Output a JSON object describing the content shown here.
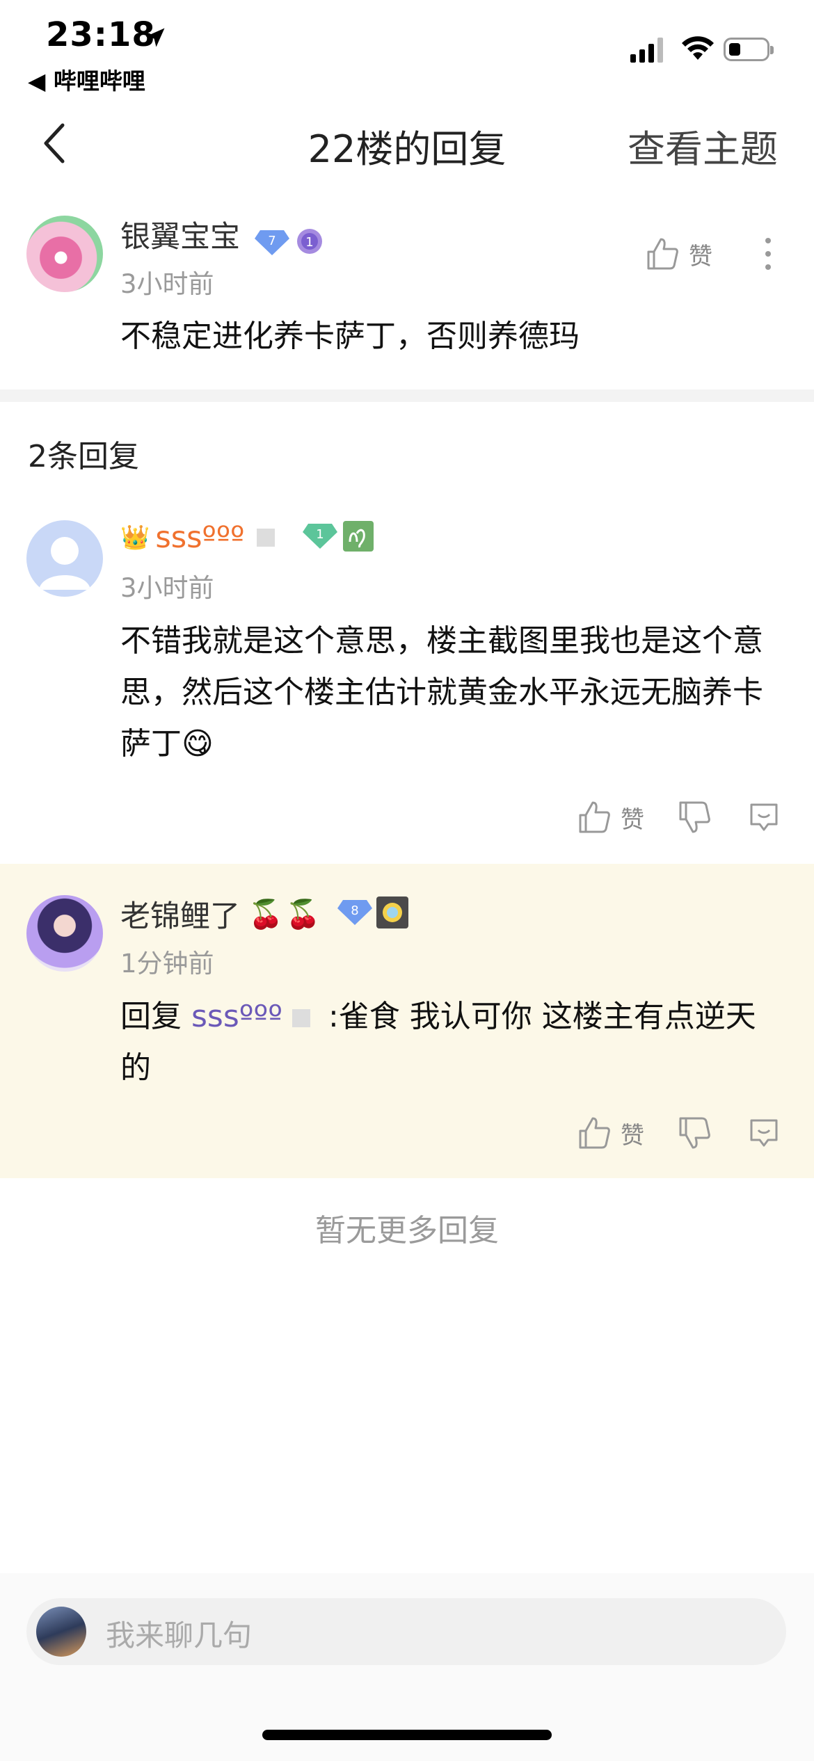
{
  "status": {
    "time": "23:18",
    "back_app": "◀ 哔哩哔哩"
  },
  "nav": {
    "title": "22楼的回复",
    "topic_link": "查看主题"
  },
  "main_post": {
    "user": "银翼宝宝",
    "level": "7",
    "badge": "1",
    "time": "3小时前",
    "content": "不稳定进化养卡萨丁，否则养德玛",
    "like_label": "赞"
  },
  "reply_count": "2条回复",
  "replies": [
    {
      "user": "sssººº",
      "level": "1",
      "time": "3小时前",
      "content": "不错我就是这个意思，楼主截图里我也是这个意思，然后这个楼主估计就黄金水平永远无脑养卡萨丁",
      "emoji": "😋",
      "like_label": "赞"
    },
    {
      "user": "老锦鲤了",
      "emoji_tag": "🍒🍒",
      "level": "8",
      "time": "1分钟前",
      "reply_prefix": "回复 ",
      "reply_target": "sssººº",
      "content": " :雀食 我认可你 这楼主有点逆天的",
      "like_label": "赞"
    }
  ],
  "no_more": "暂无更多回复",
  "input": {
    "placeholder": "我来聊几句"
  },
  "colors": {
    "accent_purple": "#6b59b8",
    "orange": "#f0712e",
    "highlight_bg": "#fcf8e8"
  }
}
